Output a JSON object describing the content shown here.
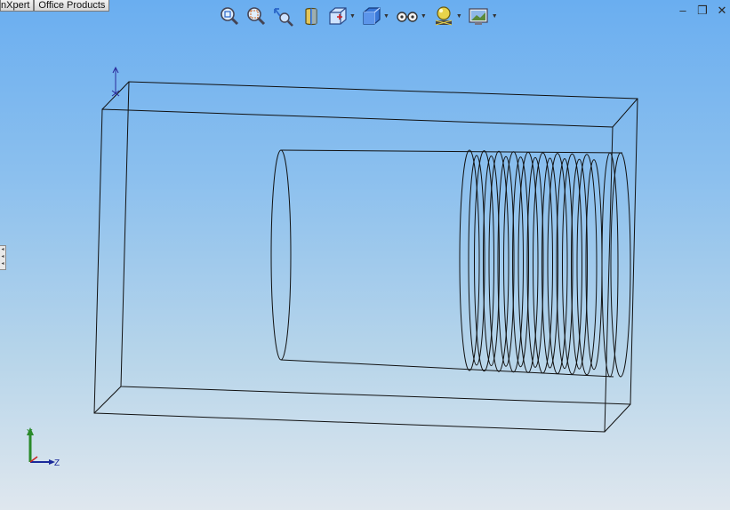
{
  "tabs": [
    {
      "label": "nXpert"
    },
    {
      "label": "Office Products"
    }
  ],
  "toolbar": {
    "items": [
      {
        "icon": "zoom-to-fit-icon",
        "dropdown": false
      },
      {
        "icon": "zoom-to-area-icon",
        "dropdown": false
      },
      {
        "icon": "previous-view-icon",
        "dropdown": false
      },
      {
        "icon": "section-view-icon",
        "dropdown": false
      },
      {
        "icon": "view-orientation-icon",
        "dropdown": true
      },
      {
        "icon": "display-style-icon",
        "dropdown": true
      },
      {
        "icon": "hide-show-items-icon",
        "dropdown": true
      },
      {
        "icon": "edit-appearance-icon",
        "dropdown": true
      },
      {
        "icon": "apply-scene-icon",
        "dropdown": true
      }
    ]
  },
  "window_controls": {
    "minimize": "–",
    "restore": "❐",
    "close": "✕"
  },
  "triad": {
    "y_label": "Y",
    "z_label": "Z"
  },
  "colors": {
    "background_top": "#6aaef0",
    "background_bottom": "#dfe7ee",
    "wireframe": "#111111",
    "triad_y": "#2a8a2a",
    "triad_z": "#1a2a9a"
  }
}
